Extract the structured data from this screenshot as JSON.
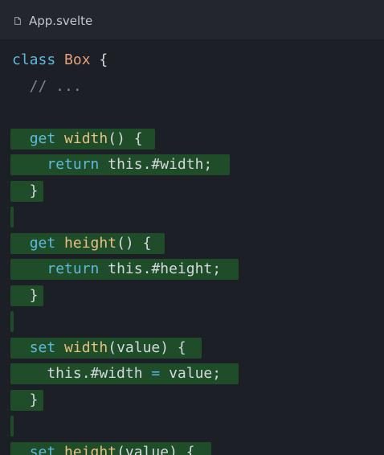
{
  "editor": {
    "filename": "App.svelte",
    "file_icon": "file-icon",
    "colors": {
      "background": "#1c1f26",
      "titlebar": "#23262e",
      "added_line_highlight": "#1f4d2a",
      "keyword": "#5fb9dd",
      "class_name": "#e7a07d",
      "function_name": "#e8c083",
      "comment": "#7e8693",
      "plain": "#d5d8dd"
    }
  },
  "code_lines": [
    {
      "highlighted": false,
      "tokens": [
        {
          "t": "class",
          "k": "kw"
        },
        {
          "t": " ",
          "k": "pl"
        },
        {
          "t": "Box",
          "k": "cls"
        },
        {
          "t": " {",
          "k": "pl"
        }
      ]
    },
    {
      "highlighted": false,
      "tokens": [
        {
          "t": "  // ...",
          "k": "cm"
        }
      ]
    },
    {
      "highlighted": false,
      "tokens": []
    },
    {
      "highlighted": true,
      "tokens": [
        {
          "t": "  ",
          "k": "pl"
        },
        {
          "t": "get",
          "k": "kw"
        },
        {
          "t": " ",
          "k": "pl"
        },
        {
          "t": "width",
          "k": "fn"
        },
        {
          "t": "() {",
          "k": "pl"
        }
      ]
    },
    {
      "highlighted": true,
      "tokens": [
        {
          "t": "    ",
          "k": "pl"
        },
        {
          "t": "return",
          "k": "kw"
        },
        {
          "t": " this.#width;",
          "k": "pl"
        }
      ]
    },
    {
      "highlighted": true,
      "tokens": [
        {
          "t": "  }",
          "k": "pl"
        }
      ]
    },
    {
      "highlighted": true,
      "tokens": []
    },
    {
      "highlighted": true,
      "tokens": [
        {
          "t": "  ",
          "k": "pl"
        },
        {
          "t": "get",
          "k": "kw"
        },
        {
          "t": " ",
          "k": "pl"
        },
        {
          "t": "height",
          "k": "fn"
        },
        {
          "t": "() {",
          "k": "pl"
        }
      ]
    },
    {
      "highlighted": true,
      "tokens": [
        {
          "t": "    ",
          "k": "pl"
        },
        {
          "t": "return",
          "k": "kw"
        },
        {
          "t": " this.#height;",
          "k": "pl"
        }
      ]
    },
    {
      "highlighted": true,
      "tokens": [
        {
          "t": "  }",
          "k": "pl"
        }
      ]
    },
    {
      "highlighted": true,
      "tokens": []
    },
    {
      "highlighted": true,
      "tokens": [
        {
          "t": "  ",
          "k": "pl"
        },
        {
          "t": "set",
          "k": "kw"
        },
        {
          "t": " ",
          "k": "pl"
        },
        {
          "t": "width",
          "k": "fn"
        },
        {
          "t": "(value) {",
          "k": "pl"
        }
      ]
    },
    {
      "highlighted": true,
      "tokens": [
        {
          "t": "    this.#width ",
          "k": "pl"
        },
        {
          "t": "=",
          "k": "op"
        },
        {
          "t": " value;",
          "k": "pl"
        }
      ]
    },
    {
      "highlighted": true,
      "tokens": [
        {
          "t": "  }",
          "k": "pl"
        }
      ]
    },
    {
      "highlighted": true,
      "tokens": []
    },
    {
      "highlighted": true,
      "tokens": [
        {
          "t": "  ",
          "k": "pl"
        },
        {
          "t": "set",
          "k": "kw"
        },
        {
          "t": " ",
          "k": "pl"
        },
        {
          "t": "height",
          "k": "fn"
        },
        {
          "t": "(value) {",
          "k": "pl"
        }
      ]
    }
  ]
}
